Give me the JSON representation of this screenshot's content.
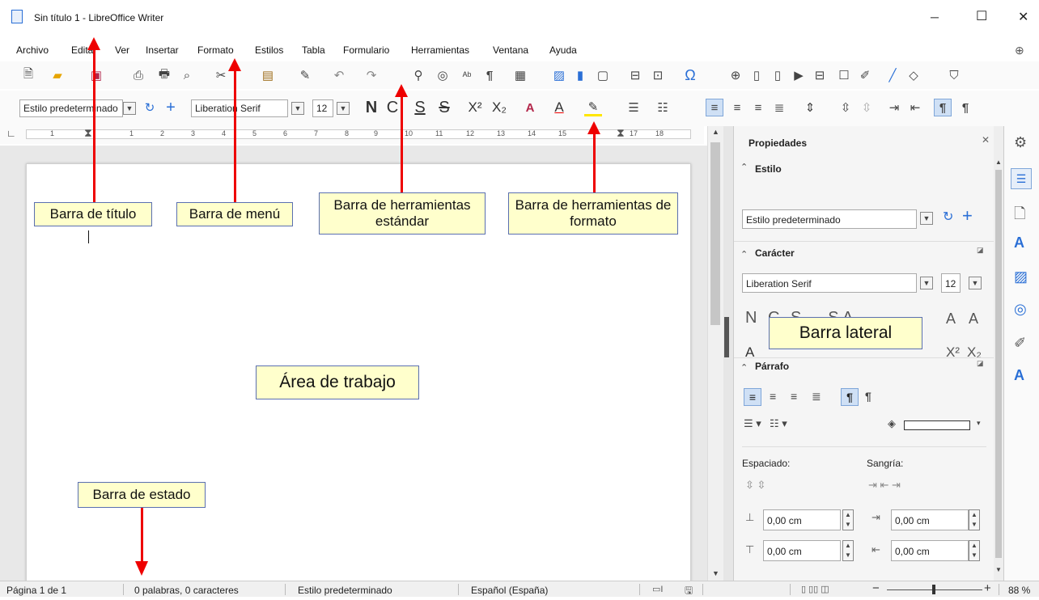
{
  "window": {
    "title": "Sin título 1 - LibreOffice Writer",
    "minimize": "─",
    "maximize": "☐",
    "close": "✕"
  },
  "menu": {
    "items": [
      "Archivo",
      "Editar",
      "Ver",
      "Insertar",
      "Formato",
      "Estilos",
      "Tabla",
      "Formulario",
      "Herramientas",
      "Ventana",
      "Ayuda"
    ]
  },
  "format_toolbar": {
    "paragraph_style": "Estilo predeterminado",
    "font_name": "Liberation Serif",
    "font_size": "12",
    "bold": "N",
    "italic": "C",
    "underline": "S",
    "strike": "S",
    "superscript": "X²",
    "subscript": "X₂"
  },
  "ruler": {
    "numbers": [
      "1",
      "1",
      "2",
      "3",
      "4",
      "5",
      "6",
      "7",
      "8",
      "9",
      "10",
      "11",
      "12",
      "13",
      "14",
      "15",
      "17",
      "18"
    ]
  },
  "sidebar": {
    "title": "Propiedades",
    "style_section": "Estilo",
    "style_value": "Estilo predeterminado",
    "char_section": "Carácter",
    "char_font": "Liberation Serif",
    "char_size": "12",
    "char_buttons": "N C S",
    "char_super": "X²",
    "char_sub": "X₂",
    "para_section": "Párrafo",
    "spacing_label": "Espaciado:",
    "indent_label": "Sangría:",
    "spacing_above": "0,00 cm",
    "spacing_below": "0,00 cm",
    "indent_before": "0,00 cm",
    "indent_after": "0,00 cm"
  },
  "statusbar": {
    "page": "Página 1 de 1",
    "words": "0 palabras, 0 caracteres",
    "style": "Estilo predeterminado",
    "language": "Español (España)",
    "zoom": "88 %"
  },
  "callouts": {
    "title_bar": "Barra de título",
    "menu_bar": "Barra de menú",
    "standard_toolbar": "Barra de herramientas estándar",
    "format_toolbar": "Barra de herramientas de formato",
    "sidebar": "Barra lateral",
    "work_area": "Área de trabajo",
    "status_bar": "Barra de estado"
  },
  "colors": {
    "arrow": "#e00000",
    "callout_bg": "#ffffcc",
    "callout_border": "#5a6fb0",
    "accent_blue": "#2a6fd6"
  }
}
